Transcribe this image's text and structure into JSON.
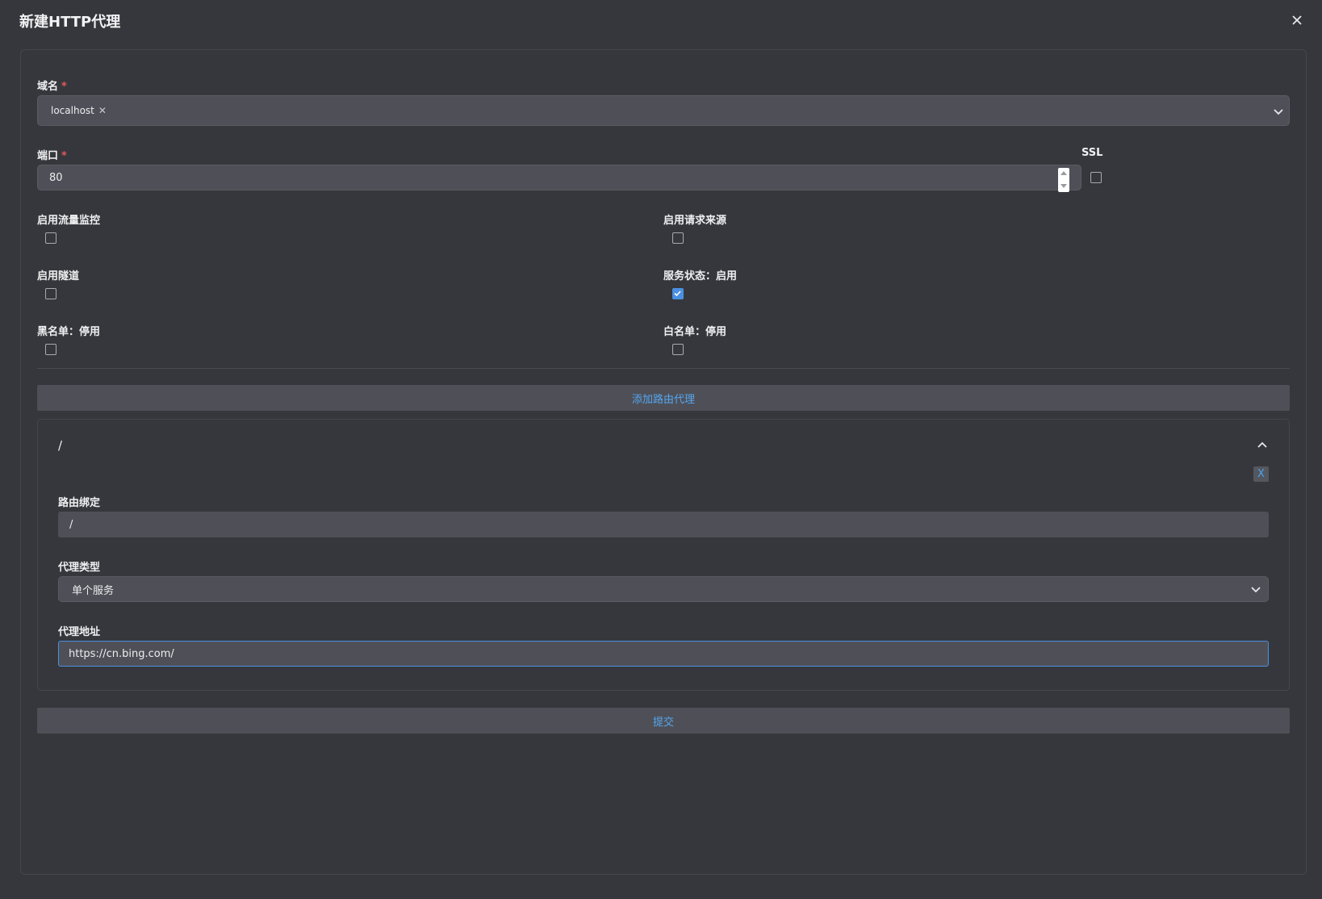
{
  "dialog": {
    "title": "新建HTTP代理",
    "close_icon": "close-icon"
  },
  "domain_field": {
    "label": "域名",
    "required_mark": "*",
    "tags": [
      "localhost"
    ],
    "tag_remove": "✕"
  },
  "port_field": {
    "label": "端口",
    "required_mark": "*",
    "value": "80"
  },
  "ssl": {
    "label": "SSL",
    "checked": false
  },
  "options": {
    "traffic_monitor": {
      "label": "启用流量监控",
      "checked": false
    },
    "request_source": {
      "label": "启用请求来源",
      "checked": false
    },
    "tunnel": {
      "label": "启用隧道",
      "checked": false
    },
    "service_status": {
      "label": "服务状态：启用",
      "checked": true
    },
    "blacklist": {
      "label": "黑名单：停用",
      "checked": false
    },
    "whitelist": {
      "label": "白名单：停用",
      "checked": false
    }
  },
  "add_route_button": "添加路由代理",
  "route": {
    "title": "/",
    "remove_label": "X",
    "binding_label": "路由绑定",
    "binding_value": "/",
    "proxy_type_label": "代理类型",
    "proxy_type_value": "单个服务",
    "proxy_address_label": "代理地址",
    "proxy_address_value": "https://cn.bing.com/"
  },
  "submit_button": "提交",
  "colors": {
    "background": "#36373c",
    "field": "#4f5057",
    "accent": "#4a90e2",
    "link": "#55a6f0",
    "required": "#e05a5a"
  }
}
